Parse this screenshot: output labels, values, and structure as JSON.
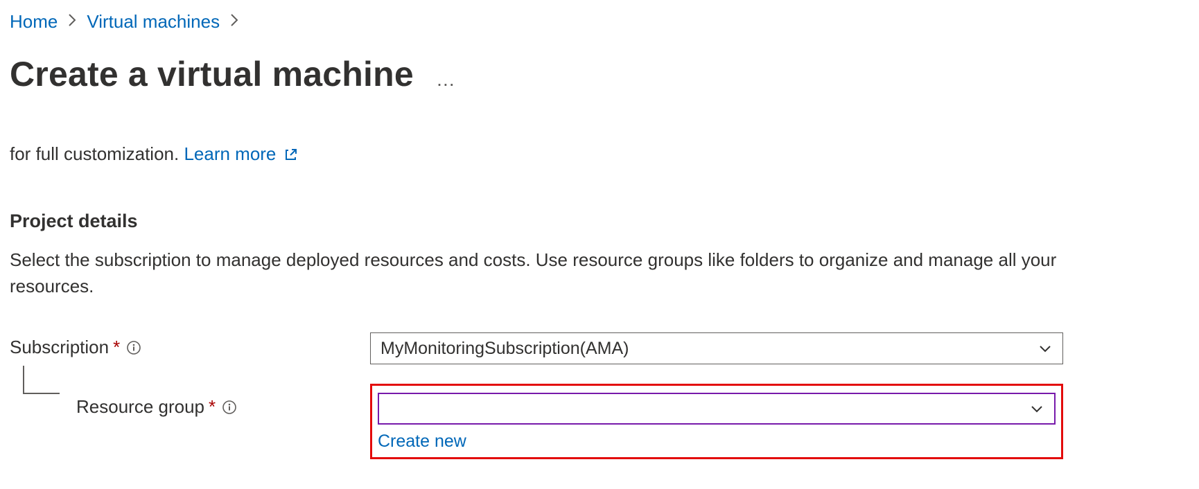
{
  "breadcrumb": {
    "home": "Home",
    "vms": "Virtual machines"
  },
  "title": "Create a virtual machine",
  "intro": {
    "fragment": "for full customization. ",
    "learn_more": "Learn more"
  },
  "project": {
    "heading": "Project details",
    "desc": "Select the subscription to manage deployed resources and costs. Use resource groups like folders to organize and manage all your resources."
  },
  "form": {
    "subscription": {
      "label": "Subscription",
      "value": "MyMonitoringSubscription(AMA)"
    },
    "resource_group": {
      "label": "Resource group",
      "value": "",
      "create_new": "Create new"
    }
  },
  "glyphs": {
    "required": "*",
    "ellipsis": "…"
  }
}
